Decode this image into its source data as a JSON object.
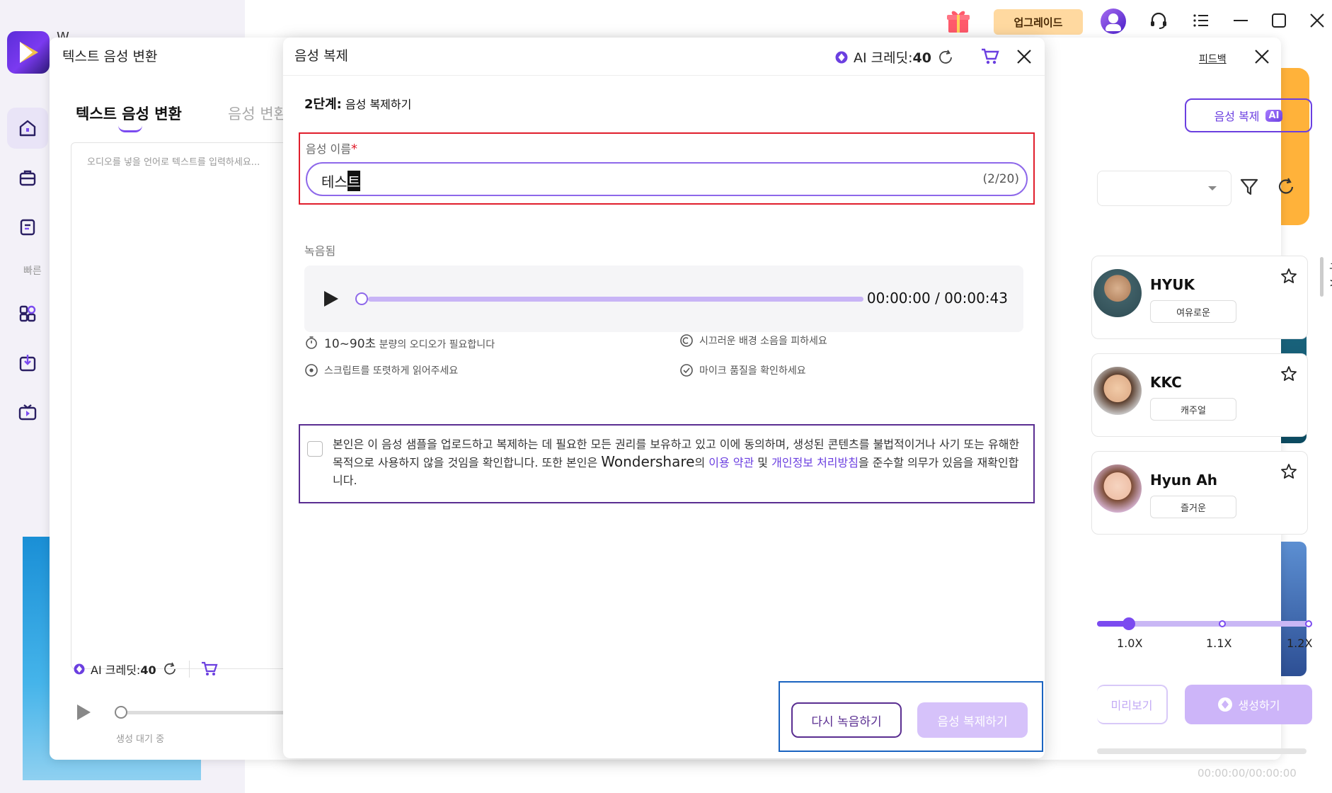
{
  "app": {
    "name": "W",
    "upgrade_label": "업그레이드",
    "fast_label": "빠른"
  },
  "tts_window": {
    "title": "텍스트 음성 변환",
    "feedback": "피드백",
    "tab_active": "텍스트 음성 변환",
    "tab_inactive": "음성 변환",
    "placeholder": "오디오를 넣을 언어로 텍스트를 입력하세요...",
    "credits_label": "AI 크레딧:",
    "credits_value": "40",
    "status": "생성 대기 중"
  },
  "right_panel": {
    "clone_button": "음성 복제",
    "clone_badge": "AI",
    "more": "구 >",
    "voices": [
      {
        "name": "HYUK",
        "tag": "여유로운"
      },
      {
        "name": "KKC",
        "tag": "캐주얼"
      },
      {
        "name": "Hyun Ah",
        "tag": "즐거운"
      }
    ],
    "speed_levels": [
      "1.0X",
      "1.1X",
      "1.2X"
    ],
    "speed_value": 1.0,
    "preview_button": "미리보기",
    "generate_button": "생성하기",
    "time": "00:00:00/00:00:00"
  },
  "modal": {
    "title": "음성 복제",
    "credits_label": "AI 크레딧:",
    "credits_value": "40",
    "step_prefix": "2단계:",
    "step_title": "음성 복제하기",
    "name_label": "음성 이름",
    "name_required": "*",
    "name_value_prefix": "테스",
    "name_value_cursor": "트",
    "name_count": "(2/20)",
    "recorded_label": "녹음됨",
    "player_progress": 0.0,
    "player_time": "00:00:00 / 00:00:43",
    "tips": {
      "duration_big": "10~90초",
      "duration_rest": "분량의 오디오가 필요합니다",
      "noise": "시끄러운 배경 소음을 피하세요",
      "script": "스크립트를 또렷하게 읽어주세요",
      "mic": "마이크 품질을 확인하세요"
    },
    "consent": {
      "part1": "본인은 이 음성 샘플을 업로드하고 복제하는 데 필요한 모든 권리를 보유하고 있고 이에 동의하며, 생성된 콘텐츠를 불법적이거나 사기 또는 유해한 목적으로 사용하지 않을 것임을 확인합니다. 또한 본인은 ",
      "brand": "Wondershare",
      "part2": "의 ",
      "terms_link": "이용 약관",
      "and": " 및 ",
      "privacy_link": "개인정보 처리방침",
      "part3": "을 준수할 의무가 있음을 재확인합니다."
    },
    "rerecord_button": "다시 녹음하기",
    "clone_button": "음성 복제하기"
  },
  "colors": {
    "accent": "#7b4bf0",
    "highlight_red": "#e01e2c",
    "highlight_purple": "#5a2e91",
    "highlight_blue": "#1a63c0"
  }
}
